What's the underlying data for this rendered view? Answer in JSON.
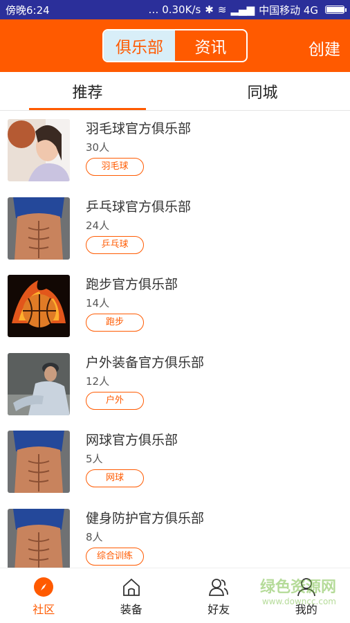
{
  "status_bar": {
    "time": "傍晚6:24",
    "speed": "… 0.30K/s",
    "carrier": "中国移动 4G",
    "battery_level": 0.95
  },
  "header": {
    "tabs": [
      {
        "label": "俱乐部",
        "active": true
      },
      {
        "label": "资讯",
        "active": false
      }
    ],
    "create_label": "创建",
    "accent_color": "#ff5a00"
  },
  "subtabs": [
    {
      "label": "推荐",
      "active": true
    },
    {
      "label": "同城",
      "active": false
    }
  ],
  "clubs": [
    {
      "title": "羽毛球官方俱乐部",
      "count": "30人",
      "tag": "羽毛球",
      "thumb": "badminton-player-photo"
    },
    {
      "title": "乒乓球官方俱乐部",
      "count": "24人",
      "tag": "乒乓球",
      "thumb": "abs-athlete-photo"
    },
    {
      "title": "跑步官方俱乐部",
      "count": "14人",
      "tag": "跑步",
      "thumb": "flaming-basketball-photo"
    },
    {
      "title": "户外装备官方俱乐部",
      "count": "12人",
      "tag": "户外",
      "thumb": "outdoor-man-photo"
    },
    {
      "title": "网球官方俱乐部",
      "count": "5人",
      "tag": "网球",
      "thumb": "abs-athlete-photo"
    },
    {
      "title": "健身防护官方俱乐部",
      "count": "8人",
      "tag": "综合训练",
      "thumb": "abs-athlete-photo"
    }
  ],
  "bottom_nav": [
    {
      "label": "社区",
      "icon": "compass-icon",
      "active": true
    },
    {
      "label": "装备",
      "icon": "home-icon",
      "active": false
    },
    {
      "label": "好友",
      "icon": "friends-icon",
      "active": false
    },
    {
      "label": "我的",
      "icon": "profile-icon",
      "active": false
    }
  ],
  "watermark": {
    "big": "绿色资源网",
    "small": "www.downcc.com"
  }
}
